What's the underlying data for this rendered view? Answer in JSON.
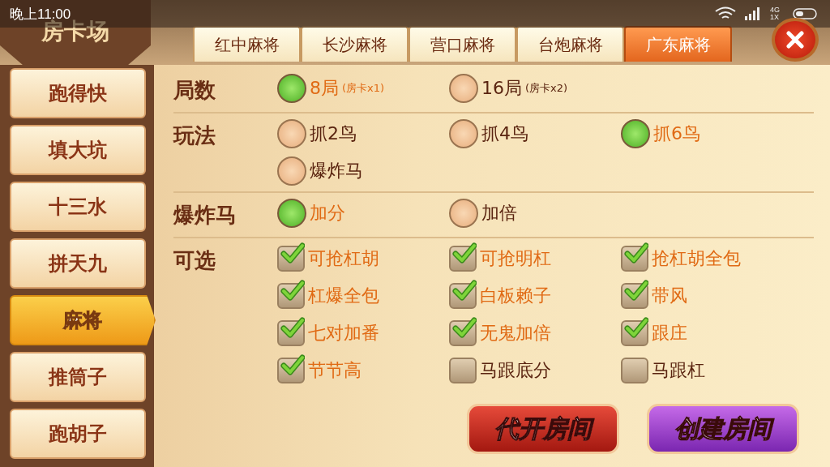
{
  "status_bar": {
    "time": "晚上11:00",
    "network": "4G 1X"
  },
  "title": "房卡场",
  "tabs": [
    {
      "label": "红中麻将",
      "selected": false
    },
    {
      "label": "长沙麻将",
      "selected": false
    },
    {
      "label": "营口麻将",
      "selected": false
    },
    {
      "label": "台炮麻将",
      "selected": false
    },
    {
      "label": "广东麻将",
      "selected": true
    }
  ],
  "sidebar": {
    "items": [
      {
        "label": "跑得快",
        "selected": false
      },
      {
        "label": "填大坑",
        "selected": false
      },
      {
        "label": "十三水",
        "selected": false
      },
      {
        "label": "拼天九",
        "selected": false
      },
      {
        "label": "麻将",
        "selected": true
      },
      {
        "label": "推筒子",
        "selected": false
      },
      {
        "label": "跑胡子",
        "selected": false
      }
    ]
  },
  "settings": [
    {
      "label": "局数",
      "kind": "radio",
      "options": [
        {
          "label": "8局",
          "note": "(房卡x1)",
          "selected": true
        },
        {
          "label": "16局",
          "note": "(房卡x2)",
          "selected": false
        }
      ]
    },
    {
      "label": "玩法",
      "kind": "radio",
      "options": [
        {
          "label": "抓2鸟",
          "selected": false
        },
        {
          "label": "抓4鸟",
          "selected": false
        },
        {
          "label": "抓6鸟",
          "selected": true
        },
        {
          "label": "爆炸马",
          "selected": false
        }
      ]
    },
    {
      "label": "爆炸马",
      "kind": "radio",
      "options": [
        {
          "label": "加分",
          "selected": true
        },
        {
          "label": "加倍",
          "selected": false
        }
      ]
    },
    {
      "label": "可选",
      "kind": "checkbox",
      "options": [
        {
          "label": "可抢杠胡",
          "checked": true
        },
        {
          "label": "可抢明杠",
          "checked": true
        },
        {
          "label": "抢杠胡全包",
          "checked": true
        },
        {
          "label": "杠爆全包",
          "checked": true
        },
        {
          "label": "白板赖子",
          "checked": true
        },
        {
          "label": "带风",
          "checked": true
        },
        {
          "label": "七对加番",
          "checked": true
        },
        {
          "label": "无鬼加倍",
          "checked": true
        },
        {
          "label": "跟庄",
          "checked": true
        },
        {
          "label": "节节高",
          "checked": true
        },
        {
          "label": "马跟底分",
          "checked": false
        },
        {
          "label": "马跟杠",
          "checked": false
        }
      ]
    }
  ],
  "buttons": [
    {
      "label": "代开房间",
      "kind": "red"
    },
    {
      "label": "创建房间",
      "kind": "purple"
    }
  ]
}
